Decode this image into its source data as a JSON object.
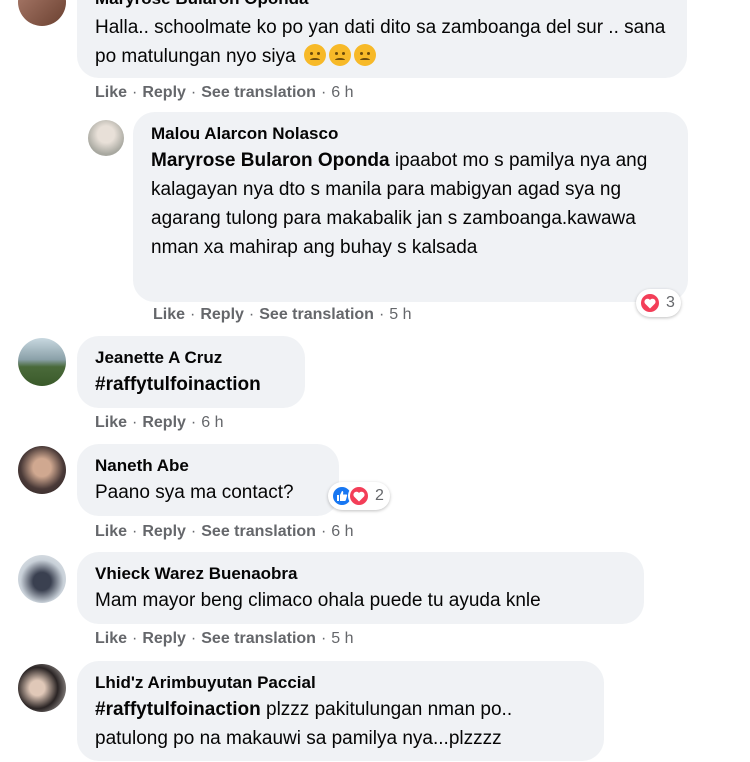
{
  "comments": [
    {
      "author": "Maryrose Bularon Oponda",
      "text": "Halla.. schoolmate ko po yan dati dito sa zamboanga del sur .. sana po matulungan nyo siya",
      "emoji": [
        "sad-face-emoji",
        "sad-face-emoji",
        "sad-face-emoji"
      ],
      "actions": {
        "like": "Like",
        "reply": "Reply",
        "translate": "See translation",
        "time": "6 h"
      }
    },
    {
      "author": "Malou Alarcon Nolasco",
      "mention": "Maryrose Bularon Oponda",
      "text": "ipaabot mo s pamilya nya ang kalagayan nya dto s manila para mabigyan agad sya ng agarang tulong para makabalik jan s zamboanga.kawawa nman xa mahirap ang buhay s kalsada",
      "reactions": {
        "icons": [
          "heart-icon"
        ],
        "count": "3",
        "colors": [
          "#f33e58"
        ]
      },
      "actions": {
        "like": "Like",
        "reply": "Reply",
        "translate": "See translation",
        "time": "5 h"
      }
    },
    {
      "author": "Jeanette A Cruz",
      "hashtag": "#raffytulfoinaction",
      "actions": {
        "like": "Like",
        "reply": "Reply",
        "time": "6 h"
      }
    },
    {
      "author": "Naneth Abe",
      "text": "Paano sya ma contact?",
      "reactions": {
        "icons": [
          "like-icon",
          "heart-icon"
        ],
        "count": "2",
        "colors": [
          "#1877f2",
          "#f33e58"
        ]
      },
      "actions": {
        "like": "Like",
        "reply": "Reply",
        "translate": "See translation",
        "time": "6 h"
      }
    },
    {
      "author": "Vhieck Warez Buenaobra",
      "text": "Mam mayor beng climaco ohala puede tu ayuda knle",
      "actions": {
        "like": "Like",
        "reply": "Reply",
        "translate": "See translation",
        "time": "5 h"
      }
    },
    {
      "author": "Lhid'z Arimbuyutan Paccial",
      "hashtag": "#raffytulfoinaction",
      "text": "plzzz pakitulungan nman po.. patulong po na makauwi sa pamilya nya...plzzzz"
    }
  ],
  "separator": "·"
}
